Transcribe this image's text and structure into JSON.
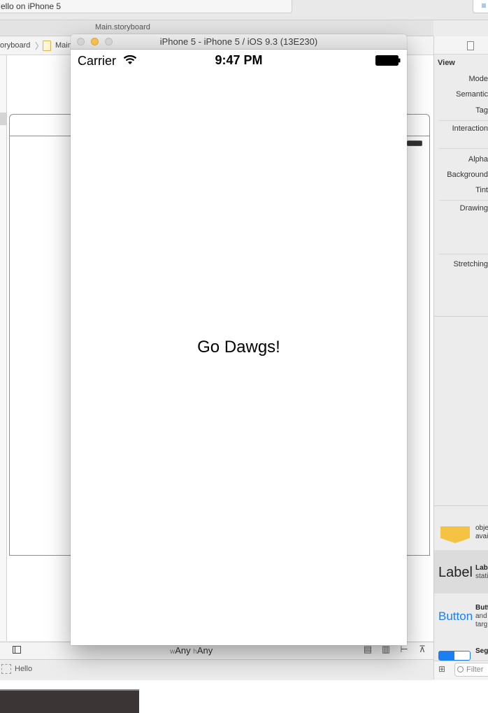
{
  "xcode": {
    "scheme_label": "ello on iPhone 5",
    "editor_icon": "≡",
    "tab_label": "Main.storyboard",
    "breadcrumb": [
      "oryboard",
      "Main"
    ],
    "size_class": {
      "w_prefix": "w",
      "w_value": "Any",
      "h_prefix": "h",
      "h_value": "Any"
    },
    "bottom_tools": [
      "align-icon",
      "pin-icon",
      "resolve-icon",
      "resize-icon"
    ],
    "debug_label": "Hello"
  },
  "inspector": {
    "section_title": "View",
    "labels": [
      "Mode",
      "Semantic",
      "Tag",
      "Interaction",
      "Alpha",
      "Background",
      "Tint",
      "Drawing",
      "Stretching"
    ]
  },
  "library": {
    "object_text_lines": [
      "obje",
      "avai"
    ],
    "label_item": {
      "preview": "Label",
      "name": "Lab",
      "desc": "stati"
    },
    "button_item": {
      "preview": "Button",
      "name": "Butt",
      "desc_lines": [
        "and",
        "targ"
      ]
    },
    "segmented_item": {
      "name": "Seg"
    },
    "filter_placeholder": "Filter"
  },
  "simulator": {
    "window_title": "iPhone 5 - iPhone 5 / iOS 9.3 (13E230)",
    "status_bar": {
      "carrier": "Carrier",
      "time": "9:47 PM"
    },
    "label_text": "Go Dawgs!"
  },
  "colors": {
    "accent_blue": "#1b7ff2",
    "minimize_light": "#f5bf4f",
    "library_object_icon": "#f5c342"
  }
}
